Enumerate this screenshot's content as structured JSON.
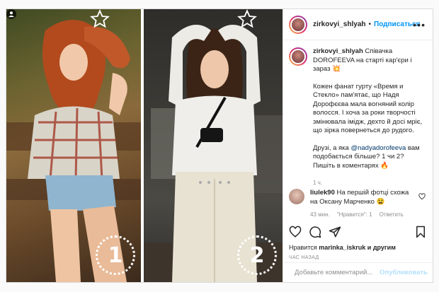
{
  "post": {
    "username": "zirkovyi_shlyah",
    "follow_label": "Подписаться",
    "dot": "•",
    "more": "•••",
    "caption": {
      "line1": "Співачка DOROFEEVA на старті кар'єри і зараз",
      "emoji1": "💥",
      "para2": "Кожен фанат гурту «Время и Стекло» пам'ятає, що Надя Дорофєєва мала вогняний колір волосся. І хоча за роки творчості змінювала імідж, дехто й досі мріє, що зірка повернеться до рудого.",
      "para3_start": "Друзі, а яка",
      "mention": "@nadyadorofeeva",
      "para3_end": "вам подобається більше? 1 чи 2? Пишіть в коментарях",
      "emoji2": "🔥",
      "time": "1 ч."
    },
    "comment": {
      "user": "liulek90",
      "text": "На першій фотці схожа на Оксану Марченко",
      "emoji": "😫",
      "time": "43 мин.",
      "likes": "\"Нравится\": 1",
      "reply": "Ответить"
    },
    "likes_prefix": "Нравится",
    "likes_user": "marinka_iskruk",
    "likes_suffix": "и другим",
    "ago": "ЧАС НАЗАД",
    "add_placeholder": "Добавьте комментарий...",
    "publish": "Опубликовать"
  },
  "photos": [
    {
      "number": "1"
    },
    {
      "number": "2"
    }
  ],
  "colors": {
    "accent": "#0095f6",
    "publish_disabled": "#b2dffc",
    "meta": "#8e8e8e"
  },
  "icons": [
    "heart-icon",
    "comment-icon",
    "share-icon",
    "bookmark-icon",
    "emoji-icon",
    "more-icon",
    "star-icon",
    "user-tag-icon"
  ]
}
